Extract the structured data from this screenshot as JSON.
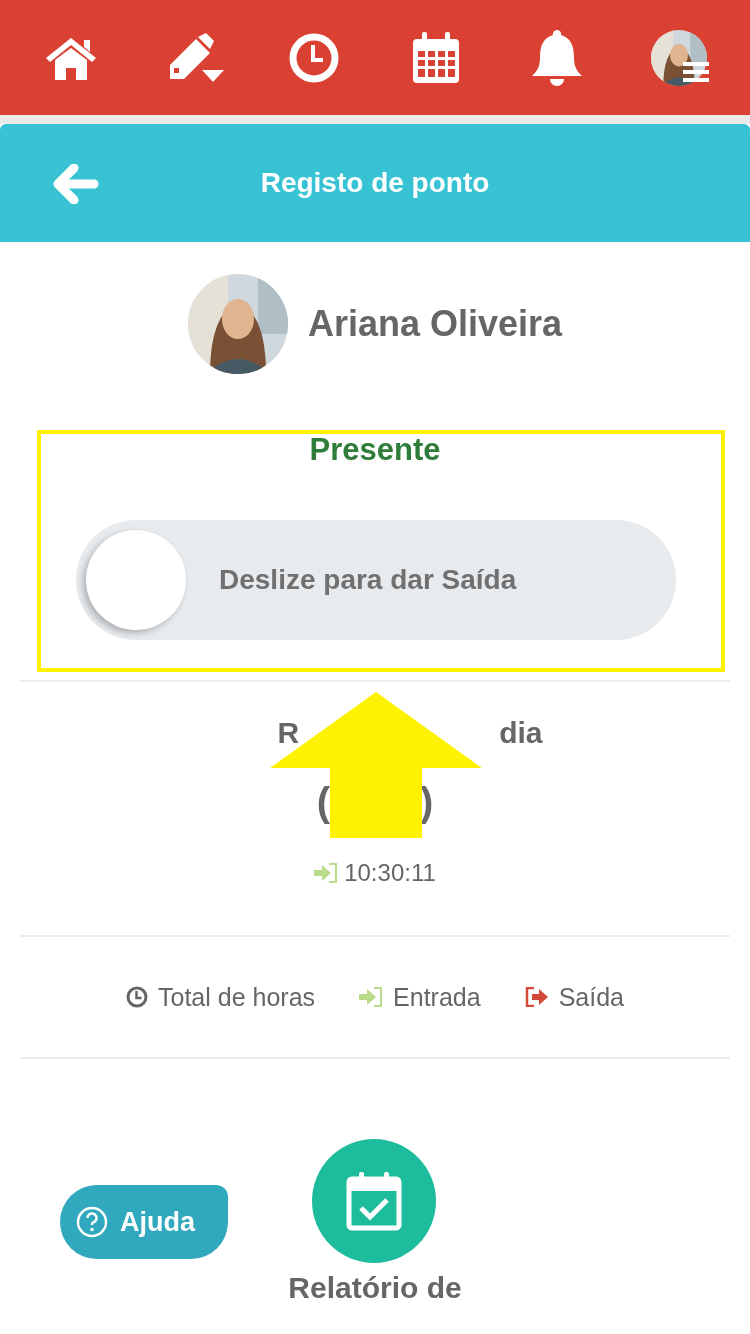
{
  "nav": [
    {
      "kind": "home"
    },
    {
      "kind": "edit"
    },
    {
      "kind": "clock"
    },
    {
      "kind": "calendar"
    },
    {
      "kind": "bell"
    },
    {
      "kind": "avatar"
    }
  ],
  "header": {
    "title": "Registo de ponto"
  },
  "profile": {
    "name": "Ariana Oliveira"
  },
  "status": {
    "label": "Presente"
  },
  "slider": {
    "label": "Deslize para dar Saída",
    "level": 0
  },
  "day": {
    "heading_left": "R",
    "heading_right": "dia",
    "total_left": "(",
    "total_right": ")",
    "entries": [
      {
        "kind": "in",
        "time": "10:30:11"
      }
    ]
  },
  "legend": [
    {
      "kind": "total",
      "label": "Total de horas"
    },
    {
      "kind": "in",
      "label": "Entrada"
    },
    {
      "kind": "out",
      "label": "Saída"
    }
  ],
  "help_button": {
    "label": "Ajuda"
  },
  "report": {
    "label": "Relatório de"
  },
  "annotation": {
    "kind": "highlight-arrow"
  }
}
